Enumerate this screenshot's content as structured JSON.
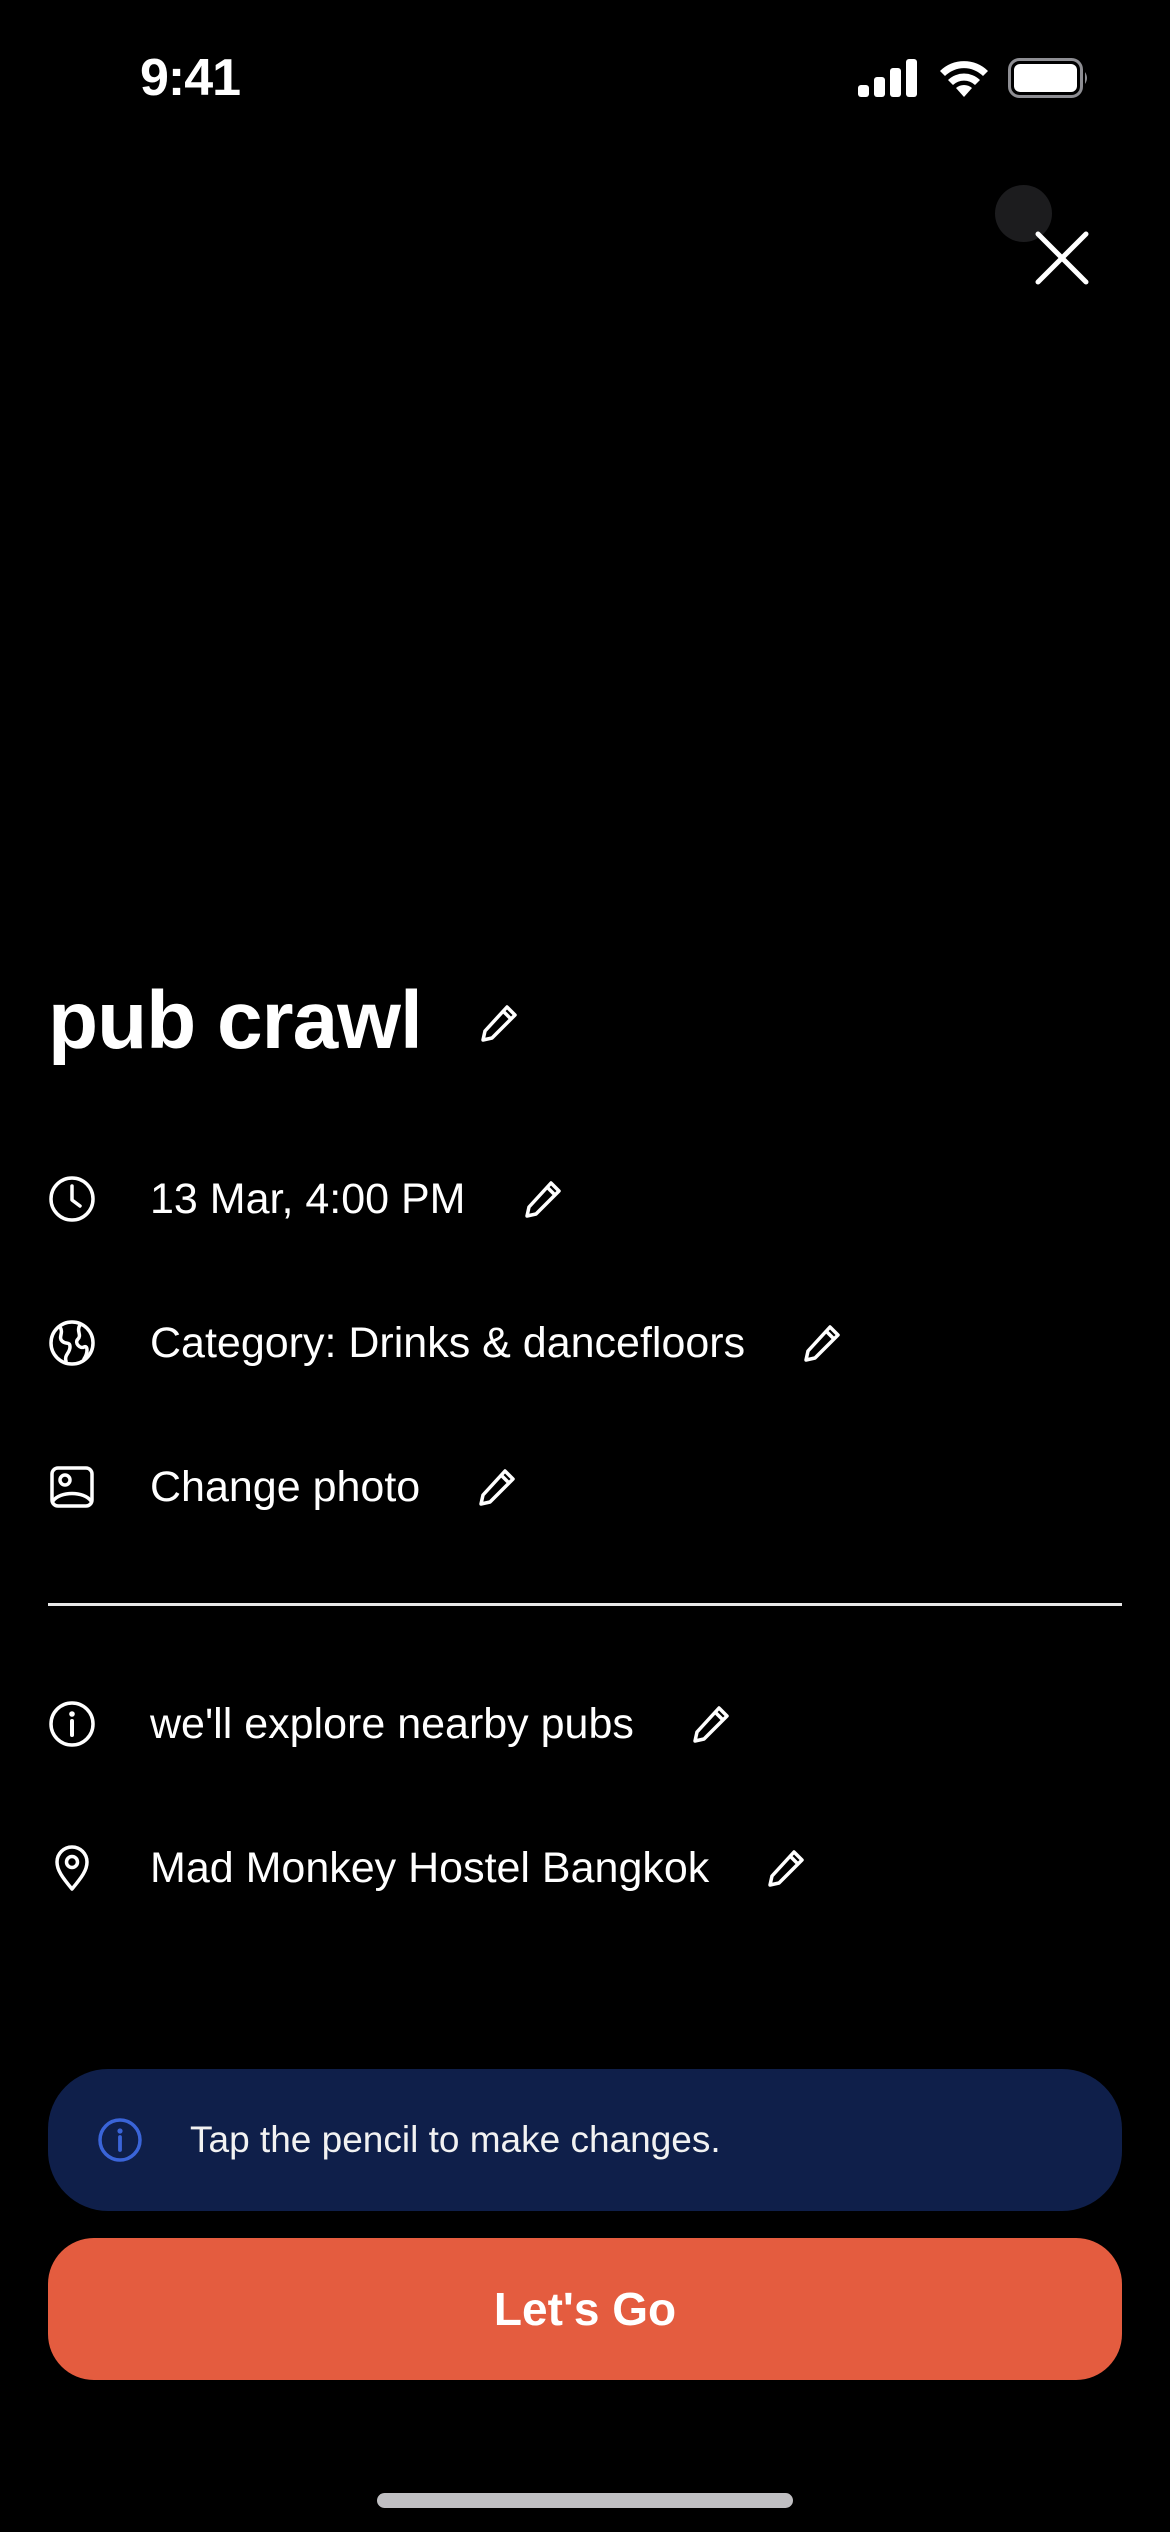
{
  "status_bar": {
    "time": "9:41",
    "icons": [
      "cellular-signal-icon",
      "wifi-icon",
      "battery-icon"
    ]
  },
  "header": {
    "close_icon": "close-icon"
  },
  "event": {
    "title": "pub crawl",
    "details": [
      {
        "icon": "clock-icon",
        "label": "13 Mar, 4:00 PM"
      },
      {
        "icon": "globe-icon",
        "label": "Category: Drinks & dancefloors"
      },
      {
        "icon": "photo-icon",
        "label": "Change photo"
      }
    ],
    "extra": [
      {
        "icon": "info-icon",
        "label": "we'll explore nearby pubs"
      },
      {
        "icon": "location-pin-icon",
        "label": "Mad Monkey Hostel Bangkok"
      }
    ]
  },
  "banner": {
    "icon": "info-icon",
    "text": "Tap the pencil to make changes."
  },
  "cta": {
    "label": "Let's Go"
  },
  "colors": {
    "background": "#000000",
    "banner_bg": "#0f1f4a",
    "banner_icon": "#3a64d8",
    "cta_bg": "#e45c3f",
    "text": "#ffffff"
  }
}
